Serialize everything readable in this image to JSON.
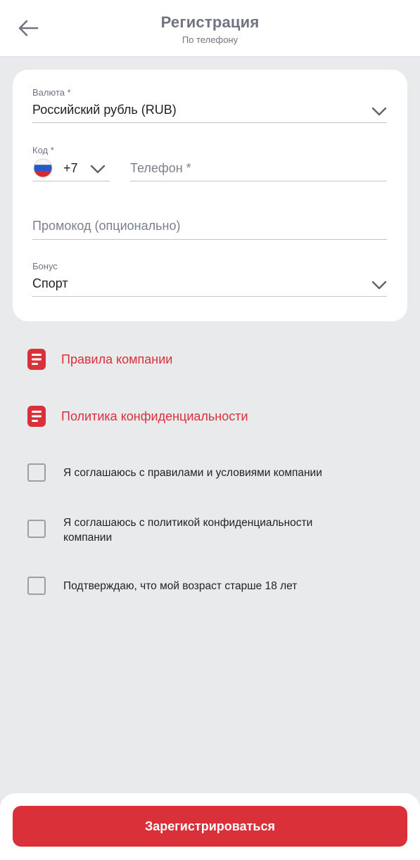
{
  "header": {
    "title": "Регистрация",
    "subtitle": "По телефону"
  },
  "form": {
    "currency": {
      "label": "Валюта *",
      "value": "Российский рубль (RUB)"
    },
    "code": {
      "label": "Код *",
      "value": "+7",
      "flag": "russia-flag-icon"
    },
    "phone": {
      "placeholder": "Телефон *"
    },
    "promo": {
      "placeholder": "Промокод (опционально)"
    },
    "bonus": {
      "label": "Бонус",
      "value": "Спорт"
    }
  },
  "links": {
    "rules": "Правила компании",
    "privacy": "Политика конфиденциальности"
  },
  "agreements": [
    {
      "label": "Я соглашаюсь с правилами и условиями компании",
      "checked": false
    },
    {
      "label": "Я соглашаюсь с политикой конфиденциальности компании",
      "checked": false
    },
    {
      "label": "Подтверждаю, что мой возраст старше 18 лет",
      "checked": false
    }
  ],
  "actions": {
    "register": "Зарегистрироваться"
  },
  "colors": {
    "accent": "#d9303a",
    "muted": "#6f7480",
    "background": "#e9eaec"
  }
}
